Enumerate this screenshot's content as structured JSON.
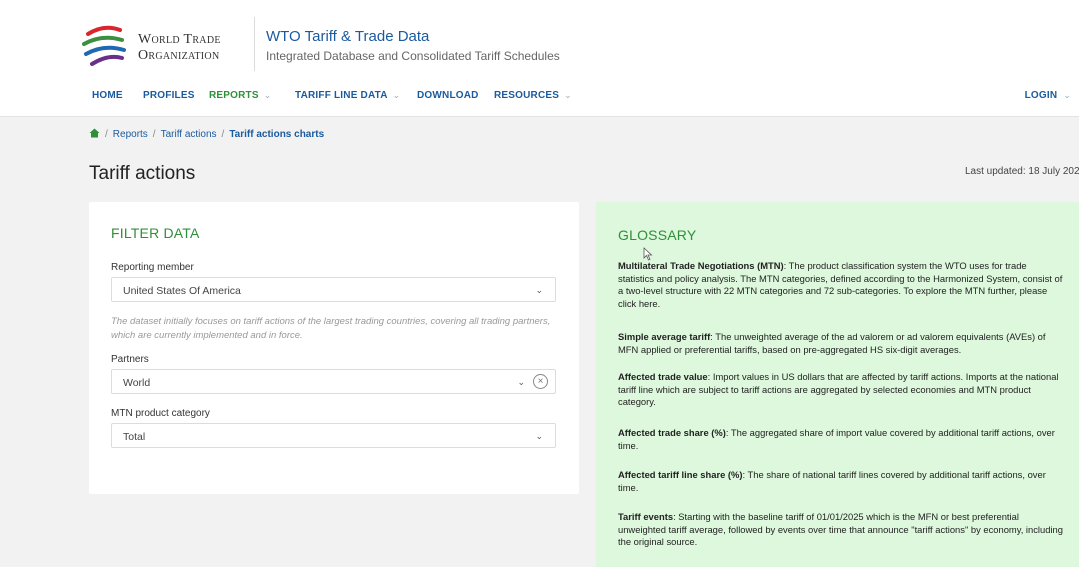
{
  "header": {
    "logo_line1": "World Trade",
    "logo_line2": "Organization",
    "site_title": "WTO Tariff & Trade Data",
    "site_subtitle": "Integrated Database and Consolidated Tariff Schedules"
  },
  "nav": {
    "items": [
      {
        "label": "HOME",
        "icon": ""
      },
      {
        "label": "PROFILES",
        "icon": ""
      },
      {
        "label": "REPORTS",
        "icon": "chevron-down-icon"
      },
      {
        "label": "TARIFF LINE DATA",
        "icon": "chevron-down-icon"
      },
      {
        "label": "DOWNLOAD",
        "icon": ""
      },
      {
        "label": "RESOURCES",
        "icon": "chevron-down-icon"
      }
    ],
    "active": "REPORTS",
    "login": "LOGIN"
  },
  "breadcrumb": {
    "home_icon": "home-icon",
    "items": [
      "Reports",
      "Tariff actions",
      "Tariff actions charts"
    ]
  },
  "page": {
    "title": "Tariff actions",
    "last_updated": "Last updated: 18 July 202"
  },
  "filter": {
    "heading": "FILTER DATA",
    "reporting_member_label": "Reporting member",
    "reporting_member_value": "United States Of America",
    "note": "The dataset initially focuses on tariff actions of the largest trading countries, covering all trading partners, which are currently implemented and in force.",
    "partners_label": "Partners",
    "partners_value": "World",
    "mtn_label": "MTN product category",
    "mtn_value": "Total"
  },
  "glossary": {
    "heading": "GLOSSARY",
    "entries": [
      {
        "term": "Multilateral Trade Negotiations (MTN)",
        "definition": ": The product classification system the WTO uses for trade statistics and policy analysis. The MTN categories, defined according to the Harmonized System, consist of a two-level structure with 22 MTN categories and 72 sub-categories. To explore the MTN further, please click here."
      },
      {
        "term": "Simple average tariff",
        "definition": ": The unweighted average of the ad valorem or ad valorem equivalents (AVEs) of MFN applied or preferential tariffs, based on pre-aggregated HS six-digit averages."
      },
      {
        "term": "Affected trade value",
        "definition": ": Import values in US dollars that are affected by tariff actions. Imports at the national tariff line which are subject to tariff actions are aggregated by selected economies and MTN product category."
      },
      {
        "term": "Affected trade share (%)",
        "definition": ": The aggregated share of import value covered by additional tariff actions, over time."
      },
      {
        "term": "Affected tariff line share (%)",
        "definition": ": The share of national tariff lines covered by additional tariff actions, over time."
      },
      {
        "term": "Tariff events",
        "definition": ": Starting with the baseline tariff of 01/01/2025 which is the MFN or best preferential unweighted tariff average, followed by events over time that announce \"tariff actions\" by economy, including the original source."
      }
    ]
  },
  "colors": {
    "link_blue": "#1a5a9e",
    "active_green": "#2f8f3a",
    "glossary_bg": "#ddf8dc",
    "page_bg": "#f2f2f2"
  }
}
